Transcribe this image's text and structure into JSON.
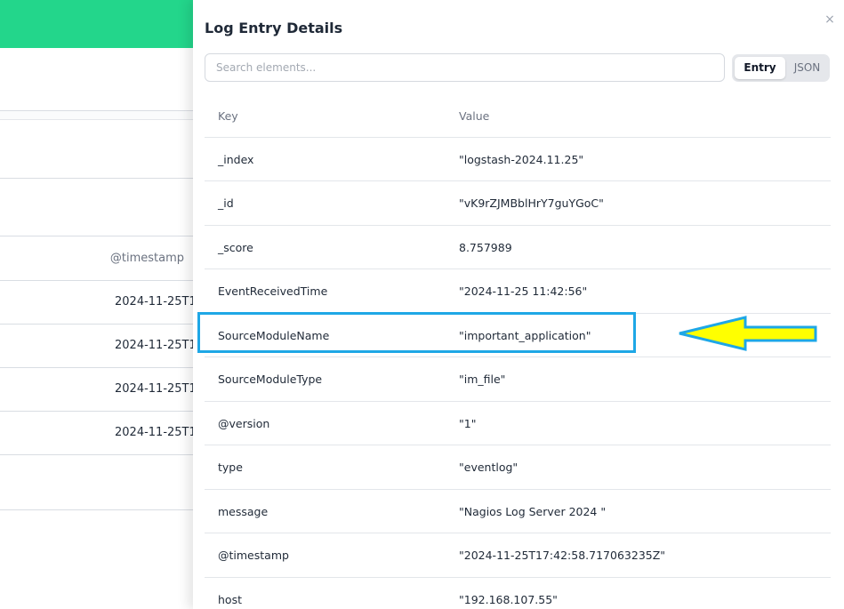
{
  "background": {
    "column_header": "@timestamp",
    "rows": [
      "2024-11-25T17",
      "2024-11-25T17",
      "2024-11-25T17",
      "2024-11-25T17"
    ]
  },
  "panel": {
    "title": "Log Entry Details",
    "close_glyph": "×",
    "search": {
      "placeholder": "Search elements..."
    },
    "toggle": {
      "entry_label": "Entry",
      "json_label": "JSON",
      "selected": "Entry"
    },
    "table": {
      "key_header": "Key",
      "value_header": "Value",
      "rows": [
        {
          "key": "_index",
          "value": "\"logstash-2024.11.25\""
        },
        {
          "key": "_id",
          "value": "\"vK9rZJMBblHrY7guYGoC\""
        },
        {
          "key": "_score",
          "value": "8.757989"
        },
        {
          "key": "EventReceivedTime",
          "value": "\"2024-11-25 11:42:56\""
        },
        {
          "key": "SourceModuleName",
          "value": "\"important_application\""
        },
        {
          "key": "SourceModuleType",
          "value": "\"im_file\""
        },
        {
          "key": "@version",
          "value": "\"1\""
        },
        {
          "key": "type",
          "value": "\"eventlog\""
        },
        {
          "key": "message",
          "value": "\"Nagios Log Server 2024 \""
        },
        {
          "key": "@timestamp",
          "value": "\"2024-11-25T17:42:58.717063235Z\""
        },
        {
          "key": "host",
          "value": "\"192.168.107.55\""
        }
      ]
    }
  },
  "annotation": {
    "highlighted_key": "SourceModuleName",
    "box_color": "#1ea7e6",
    "arrow_fill": "#ffff00",
    "arrow_stroke": "#1ea7e6"
  },
  "colors": {
    "header_accent": "#23d68b"
  }
}
